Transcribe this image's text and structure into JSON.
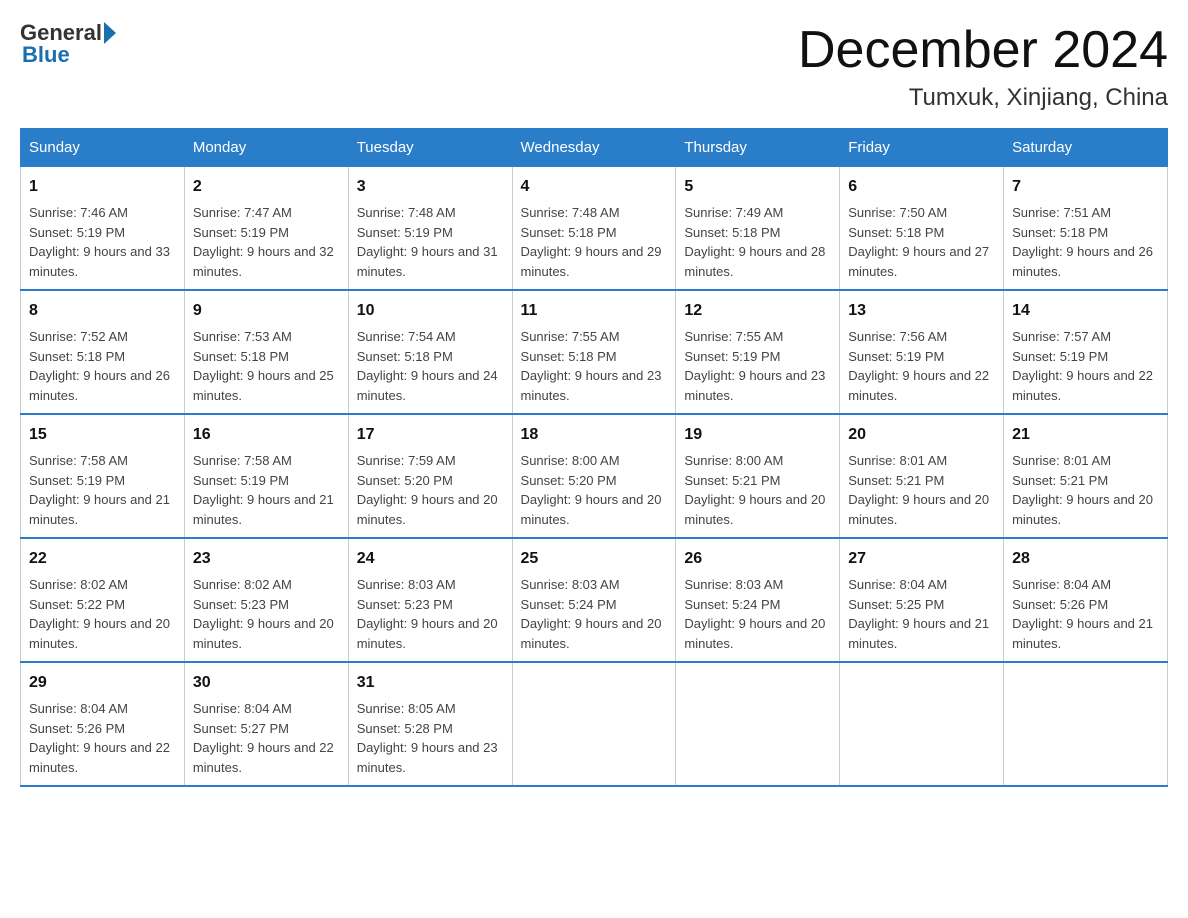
{
  "header": {
    "logo_general": "General",
    "logo_blue": "Blue",
    "month_title": "December 2024",
    "location": "Tumxuk, Xinjiang, China"
  },
  "weekdays": [
    "Sunday",
    "Monday",
    "Tuesday",
    "Wednesday",
    "Thursday",
    "Friday",
    "Saturday"
  ],
  "weeks": [
    [
      {
        "day": "1",
        "sunrise": "7:46 AM",
        "sunset": "5:19 PM",
        "daylight": "9 hours and 33 minutes."
      },
      {
        "day": "2",
        "sunrise": "7:47 AM",
        "sunset": "5:19 PM",
        "daylight": "9 hours and 32 minutes."
      },
      {
        "day": "3",
        "sunrise": "7:48 AM",
        "sunset": "5:19 PM",
        "daylight": "9 hours and 31 minutes."
      },
      {
        "day": "4",
        "sunrise": "7:48 AM",
        "sunset": "5:18 PM",
        "daylight": "9 hours and 29 minutes."
      },
      {
        "day": "5",
        "sunrise": "7:49 AM",
        "sunset": "5:18 PM",
        "daylight": "9 hours and 28 minutes."
      },
      {
        "day": "6",
        "sunrise": "7:50 AM",
        "sunset": "5:18 PM",
        "daylight": "9 hours and 27 minutes."
      },
      {
        "day": "7",
        "sunrise": "7:51 AM",
        "sunset": "5:18 PM",
        "daylight": "9 hours and 26 minutes."
      }
    ],
    [
      {
        "day": "8",
        "sunrise": "7:52 AM",
        "sunset": "5:18 PM",
        "daylight": "9 hours and 26 minutes."
      },
      {
        "day": "9",
        "sunrise": "7:53 AM",
        "sunset": "5:18 PM",
        "daylight": "9 hours and 25 minutes."
      },
      {
        "day": "10",
        "sunrise": "7:54 AM",
        "sunset": "5:18 PM",
        "daylight": "9 hours and 24 minutes."
      },
      {
        "day": "11",
        "sunrise": "7:55 AM",
        "sunset": "5:18 PM",
        "daylight": "9 hours and 23 minutes."
      },
      {
        "day": "12",
        "sunrise": "7:55 AM",
        "sunset": "5:19 PM",
        "daylight": "9 hours and 23 minutes."
      },
      {
        "day": "13",
        "sunrise": "7:56 AM",
        "sunset": "5:19 PM",
        "daylight": "9 hours and 22 minutes."
      },
      {
        "day": "14",
        "sunrise": "7:57 AM",
        "sunset": "5:19 PM",
        "daylight": "9 hours and 22 minutes."
      }
    ],
    [
      {
        "day": "15",
        "sunrise": "7:58 AM",
        "sunset": "5:19 PM",
        "daylight": "9 hours and 21 minutes."
      },
      {
        "day": "16",
        "sunrise": "7:58 AM",
        "sunset": "5:19 PM",
        "daylight": "9 hours and 21 minutes."
      },
      {
        "day": "17",
        "sunrise": "7:59 AM",
        "sunset": "5:20 PM",
        "daylight": "9 hours and 20 minutes."
      },
      {
        "day": "18",
        "sunrise": "8:00 AM",
        "sunset": "5:20 PM",
        "daylight": "9 hours and 20 minutes."
      },
      {
        "day": "19",
        "sunrise": "8:00 AM",
        "sunset": "5:21 PM",
        "daylight": "9 hours and 20 minutes."
      },
      {
        "day": "20",
        "sunrise": "8:01 AM",
        "sunset": "5:21 PM",
        "daylight": "9 hours and 20 minutes."
      },
      {
        "day": "21",
        "sunrise": "8:01 AM",
        "sunset": "5:21 PM",
        "daylight": "9 hours and 20 minutes."
      }
    ],
    [
      {
        "day": "22",
        "sunrise": "8:02 AM",
        "sunset": "5:22 PM",
        "daylight": "9 hours and 20 minutes."
      },
      {
        "day": "23",
        "sunrise": "8:02 AM",
        "sunset": "5:23 PM",
        "daylight": "9 hours and 20 minutes."
      },
      {
        "day": "24",
        "sunrise": "8:03 AM",
        "sunset": "5:23 PM",
        "daylight": "9 hours and 20 minutes."
      },
      {
        "day": "25",
        "sunrise": "8:03 AM",
        "sunset": "5:24 PM",
        "daylight": "9 hours and 20 minutes."
      },
      {
        "day": "26",
        "sunrise": "8:03 AM",
        "sunset": "5:24 PM",
        "daylight": "9 hours and 20 minutes."
      },
      {
        "day": "27",
        "sunrise": "8:04 AM",
        "sunset": "5:25 PM",
        "daylight": "9 hours and 21 minutes."
      },
      {
        "day": "28",
        "sunrise": "8:04 AM",
        "sunset": "5:26 PM",
        "daylight": "9 hours and 21 minutes."
      }
    ],
    [
      {
        "day": "29",
        "sunrise": "8:04 AM",
        "sunset": "5:26 PM",
        "daylight": "9 hours and 22 minutes."
      },
      {
        "day": "30",
        "sunrise": "8:04 AM",
        "sunset": "5:27 PM",
        "daylight": "9 hours and 22 minutes."
      },
      {
        "day": "31",
        "sunrise": "8:05 AM",
        "sunset": "5:28 PM",
        "daylight": "9 hours and 23 minutes."
      },
      null,
      null,
      null,
      null
    ]
  ]
}
